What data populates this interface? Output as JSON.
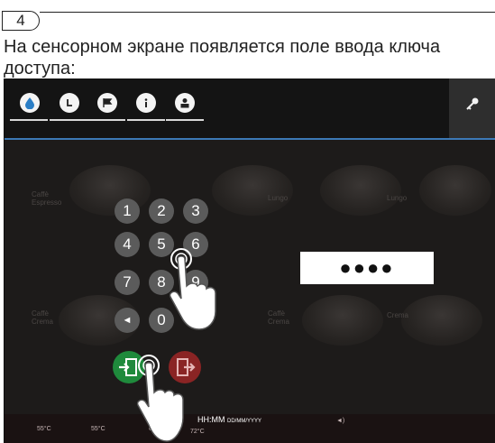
{
  "step": {
    "number": "4"
  },
  "caption": "На сенсорном экране появляется поле ввода ключа доступа:",
  "screen": {
    "top_icons": [
      "water-drop-icon",
      "clock-icon",
      "flag-icon",
      "info-icon",
      "user-icon"
    ],
    "key_icon": "key-icon",
    "keypad": {
      "keys": [
        "1",
        "2",
        "3",
        "4",
        "5",
        "6",
        "7",
        "8",
        "9",
        "◄",
        "0"
      ]
    },
    "pin_display": "●●●●",
    "buttons": {
      "enter": "door-enter-icon",
      "exit": "door-exit-icon"
    },
    "status": {
      "clock_time": "HH:MM",
      "clock_date": "DD/MM/YYYY",
      "speaker": "◄)",
      "temps": [
        "55°C",
        "55°C",
        "65°C",
        "72°C"
      ]
    },
    "ghost_labels": [
      "Caffè Espresso",
      "Lungo",
      "Lungo",
      "Caffè Crema",
      "Caffè Crema",
      "Crema"
    ],
    "colors": {
      "accent_line": "#3c79b6",
      "enter_button": "#1f8a3c",
      "exit_button": "#8a2424",
      "background": "#1d1b1a"
    }
  }
}
